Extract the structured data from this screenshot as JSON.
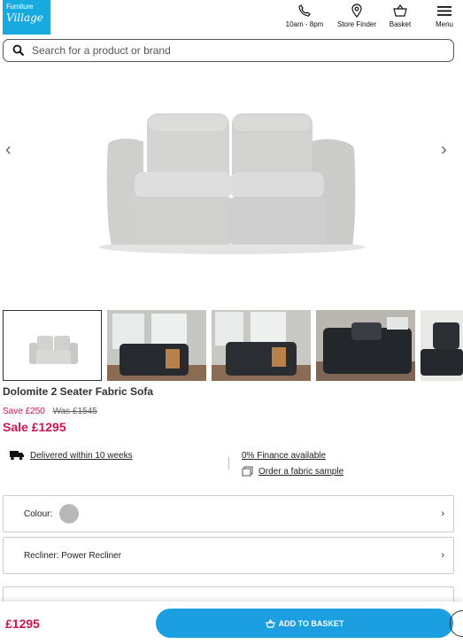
{
  "header": {
    "logo_line1": "Furniture",
    "logo_line2": "Village",
    "hours": "10am - 8pm",
    "store_finder": "Store Finder",
    "basket": "Basket",
    "menu": "Menu"
  },
  "search": {
    "placeholder": "Search for a product or brand"
  },
  "gallery": {
    "prev": "‹",
    "next": "›"
  },
  "product": {
    "name": "Dolomite 2 Seater Fabric Sofa",
    "save": "Save £250",
    "was": "Was £1545",
    "sale": "Sale £1295",
    "delivery": "Delivered within 10 weeks",
    "finance": "0% Finance available",
    "fabric_sample": "Order a fabric sample"
  },
  "options": {
    "colour_label": "Colour:",
    "recliner_label": "Recliner: Power Recliner",
    "chevron": "›"
  },
  "bottom_bar": {
    "price": "£1295",
    "add_to_basket": "ADD TO BASKET"
  },
  "colors": {
    "brand_blue": "#1c9fe0",
    "sale_pink": "#d1154f",
    "swatch": "#b8b8b6"
  }
}
